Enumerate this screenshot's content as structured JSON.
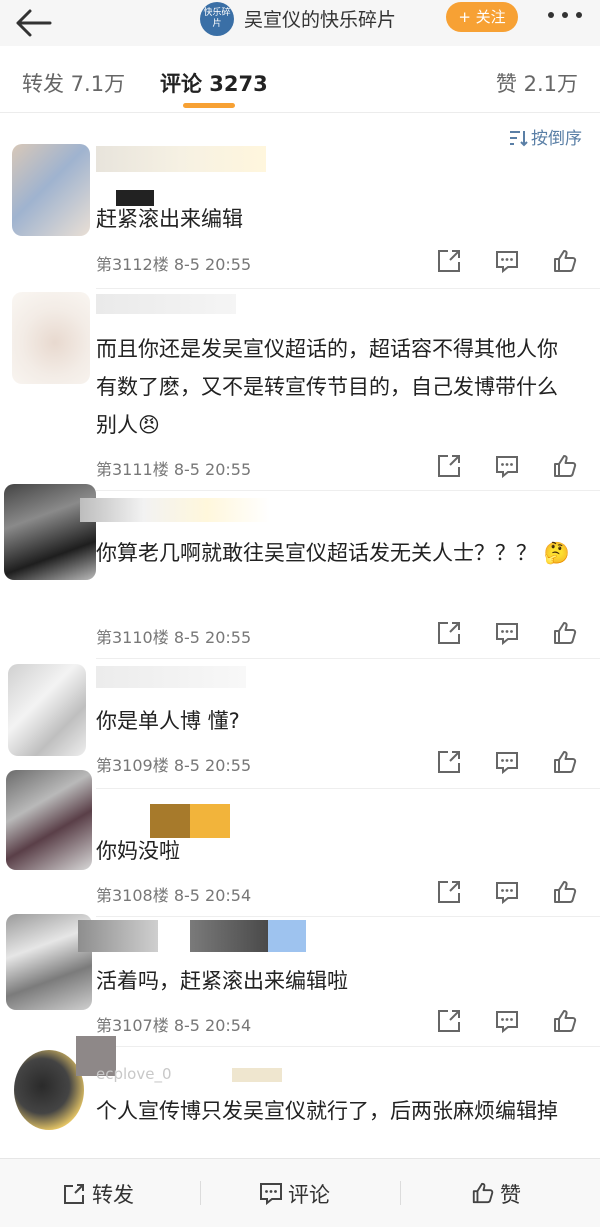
{
  "header": {
    "channel_avatar_text": "快乐碎片",
    "channel_name": "吴宣仪的快乐碎片",
    "follow_label": "+ 关注"
  },
  "tabs": {
    "repost": "转发 7.1万",
    "comment": "评论 3273",
    "like": "赞 2.1万"
  },
  "sort_label": "按倒序",
  "comments": [
    {
      "text": "赶紧滚出来编辑",
      "floor": "第3112楼",
      "time": "8-5 20:55"
    },
    {
      "text": "而且你还是发吴宣仪超话的，超话容不得其他人你有数了麽，又不是转宣传节目的，自己发博带什么别人😠",
      "floor": "第3111楼",
      "time": "8-5 20:55"
    },
    {
      "text": "你算老几啊就敢往吴宣仪超话发无关人士？？？ 🤔",
      "floor": "第3110楼",
      "time": "8-5 20:55"
    },
    {
      "text": "你是单人博 懂?",
      "floor": "第3109楼",
      "time": "8-5 20:55"
    },
    {
      "text": "你妈没啦",
      "floor": "第3108楼",
      "time": "8-5 20:54"
    },
    {
      "text": "活着吗，赶紧滚出来编辑啦",
      "floor": "第3107楼",
      "time": "8-5 20:54"
    },
    {
      "text": "个人宣传博只发吴宣仪就行了，后两张麻烦编辑掉",
      "username": "ecplove_0",
      "floor": "",
      "time": ""
    }
  ],
  "bottom_bar": {
    "repost": "转发",
    "comment": "评论",
    "like": "赞"
  },
  "colors": {
    "accent": "#f7a134",
    "link": "#5a7fa6"
  }
}
